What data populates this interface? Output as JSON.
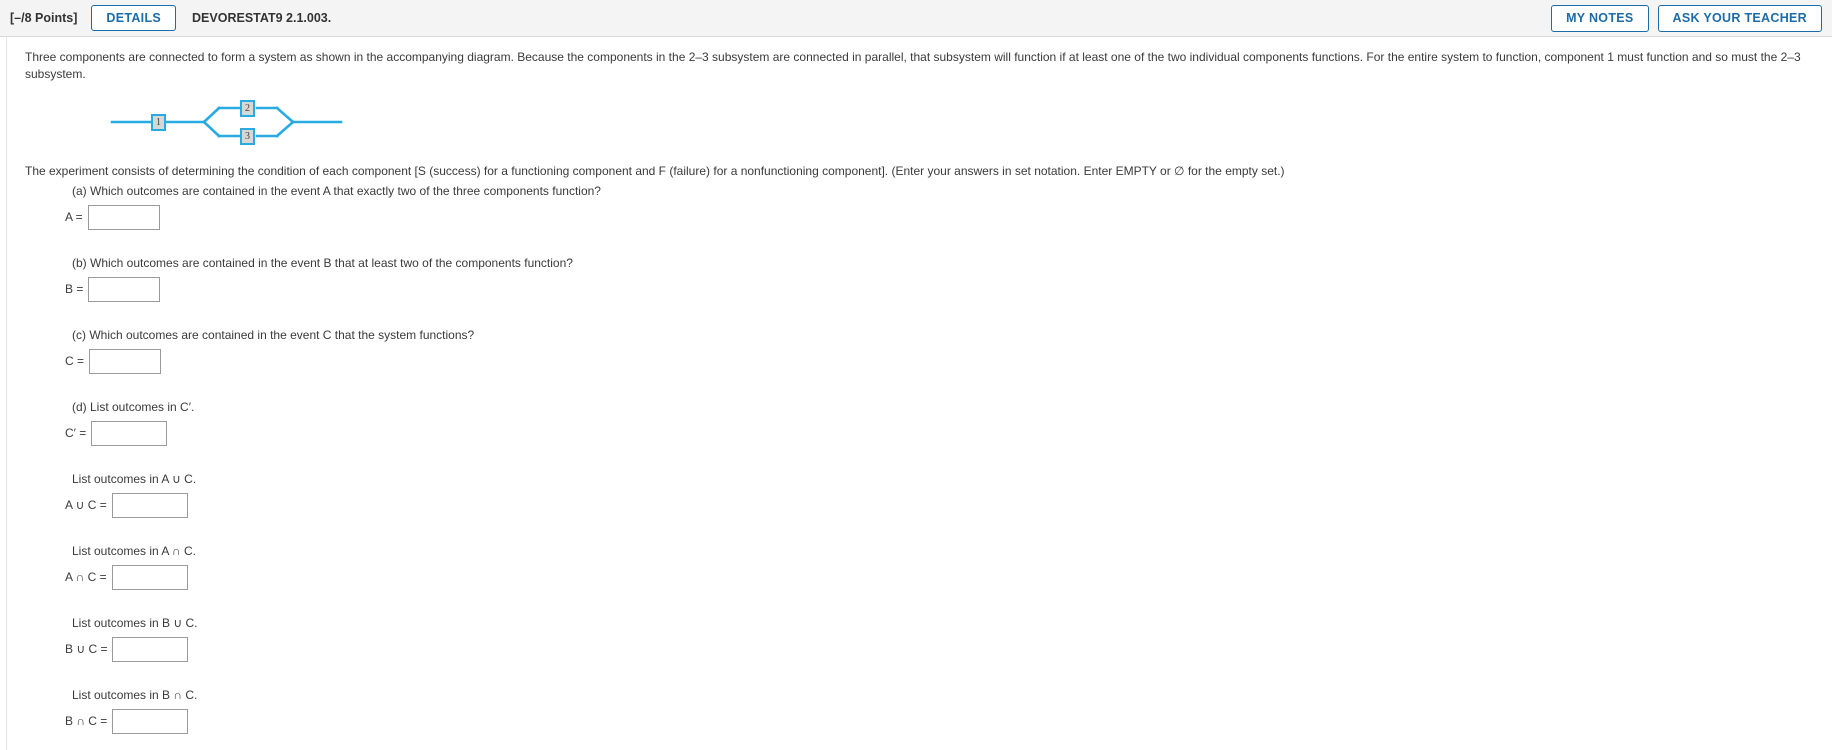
{
  "header": {
    "points": "[–/8 Points]",
    "details_label": "DETAILS",
    "question_id": "DEVORESTAT9 2.1.003.",
    "my_notes_label": "MY NOTES",
    "ask_teacher_label": "ASK YOUR TEACHER",
    "accent_color": "#1b6ca8",
    "background_color": "#f4f4f4"
  },
  "body": {
    "intro_paragraph": "Three components are connected to form a system as shown in the accompanying diagram. Because the components in the 2–3 subsystem are connected in parallel, that subsystem will function if at least one of the two individual components functions. For the entire system to function, component 1 must function and so must the 2–3 subsystem.",
    "lead_text": "The experiment consists of determining the condition of each component [S (success) for a functioning component and F (failure) for a nonfunctioning component]. (Enter your answers in set notation. Enter EMPTY or ∅ for the empty set.)"
  },
  "diagram": {
    "line_color": "#29abe2",
    "box_fill": "#d7d7d7",
    "component_1_label": "1",
    "component_2_label": "2",
    "component_3_label": "3"
  },
  "questions": [
    {
      "prompt": "(a) Which outcomes are contained in the event A that exactly two of the three components function?",
      "answer_label": "A =",
      "value": "",
      "width_class": "w72",
      "name": "answer-a"
    },
    {
      "prompt": "(b) Which outcomes are contained in the event B that at least two of the components function?",
      "answer_label": "B =",
      "value": "",
      "width_class": "w72",
      "name": "answer-b"
    },
    {
      "prompt": "(c) Which outcomes are contained in the event C that the system functions?",
      "answer_label": "C =",
      "value": "",
      "width_class": "w72",
      "name": "answer-c"
    },
    {
      "prompt": "(d) List outcomes in C′.",
      "answer_label": "C′ =",
      "value": "",
      "width_class": "w76",
      "name": "answer-c-prime"
    },
    {
      "prompt": "List outcomes in A ∪ C.",
      "answer_label": "A ∪ C =",
      "value": "",
      "width_class": "w76",
      "name": "answer-a-union-c"
    },
    {
      "prompt": "List outcomes in A ∩ C.",
      "answer_label": "A ∩ C =",
      "value": "",
      "width_class": "w76",
      "name": "answer-a-intersect-c"
    },
    {
      "prompt": "List outcomes in B ∪ C.",
      "answer_label": "B ∪ C =",
      "value": "",
      "width_class": "w76",
      "name": "answer-b-union-c"
    },
    {
      "prompt": "List outcomes in B ∩ C.",
      "answer_label": "B ∩ C =",
      "value": "",
      "width_class": "w76",
      "name": "answer-b-intersect-c"
    }
  ]
}
